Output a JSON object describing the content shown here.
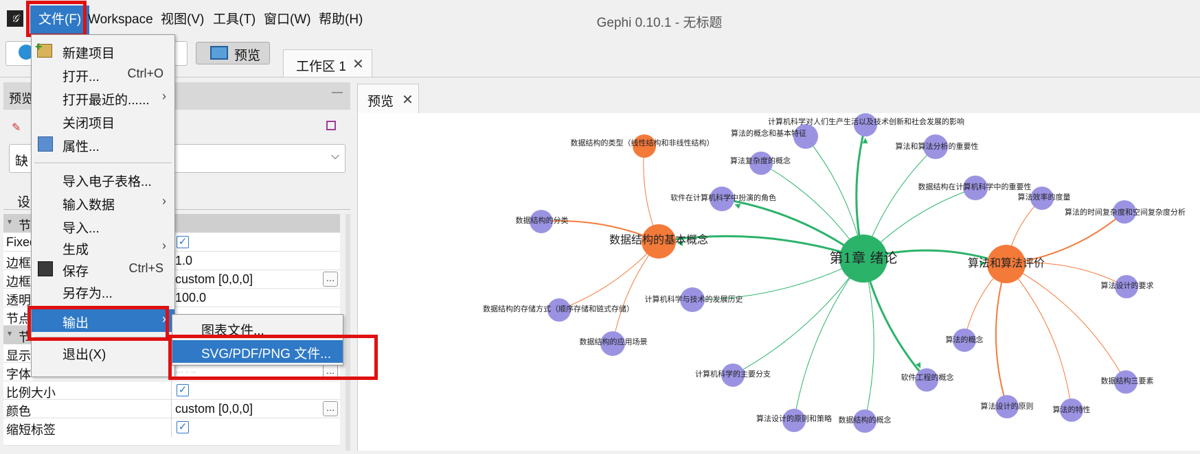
{
  "menubar": {
    "items": [
      "文件(F)",
      "Workspace",
      "视图(V)",
      "工具(T)",
      "窗口(W)",
      "帮助(H)"
    ],
    "window_title": "Gephi 0.10.1 - 无标题"
  },
  "toolbar": {
    "preview_button": "预览"
  },
  "tabs": {
    "workspace_tab": "工作区 1",
    "preview_tab": "预览"
  },
  "left_panel": {
    "title": "预览",
    "minimize": "—",
    "dropdown_value": "缺",
    "settings_label": "设",
    "section1": "节",
    "section2": "节",
    "rows": [
      {
        "name": "Fixed",
        "value": ""
      },
      {
        "name": "边框",
        "value": "1.0"
      },
      {
        "name": "边框",
        "value": "custom [0,0,0]"
      },
      {
        "name": "透明",
        "value": "100.0"
      },
      {
        "name": "节点",
        "value": ""
      },
      {
        "name": "显示",
        "value": ""
      },
      {
        "name": "字体",
        "value": "",
        "value_faint": "··· · ··"
      },
      {
        "name": "比例大小",
        "value": ""
      },
      {
        "name": "颜色",
        "value": "custom [0,0,0]"
      },
      {
        "name": "缩短标签",
        "value": ""
      }
    ]
  },
  "file_menu": {
    "new_project": "新建项目",
    "open": "打开...",
    "open_shortcut": "Ctrl+O",
    "open_recent": "打开最近的......",
    "close_project": "关闭项目",
    "properties": "属性...",
    "import_spreadsheet": "导入电子表格...",
    "import_data": "输入数据",
    "import": "导入...",
    "generate": "生成",
    "save": "保存",
    "save_shortcut": "Ctrl+S",
    "save_as": "另存为...",
    "export": "输出",
    "exit": "退出(X)"
  },
  "export_submenu": {
    "graph_file": "图表文件...",
    "svg_pdf_png": "SVG/PDF/PNG 文件..."
  },
  "graph": {
    "center": "第1章  绪论",
    "hub_left": "数据结构的基本概念",
    "hub_right": "算法和算法评价",
    "labels": {
      "n1": "计算机科学对人们生产生活以及技术创新和社会发展的影响",
      "n2": "算法的概念和基本特征",
      "n3": "算法和算法分析的重要性",
      "n4": "数据结构的类型（线性结构和非线性结构）",
      "n5": "算法复杂度的概念",
      "n6": "数据结构在计算机科学中的重要性",
      "n7": "软件在计算机科学中扮演的角色",
      "n8": "算法效率的度量",
      "n9": "算法的时间复杂度和空间复杂度分析",
      "n10": "数据结构的分类",
      "n11": "算法设计的要求",
      "n12": "计算机科学与技术的发展历史",
      "n13": "数据结构的存储方式（顺序存储和链式存储）",
      "n14": "算法的概念",
      "n15": "数据结构的应用场景",
      "n16": "软件工程的概念",
      "n17": "计算机科学的主要分支",
      "n18": "数据结构三要素",
      "n19": "算法设计的原则",
      "n20": "算法的特性",
      "n21": "算法设计的原则和策略",
      "n22": "数据结构的概念"
    },
    "colors": {
      "green": "#2bb36a",
      "orange": "#f47a3a",
      "purple": "#9b93e2"
    }
  }
}
